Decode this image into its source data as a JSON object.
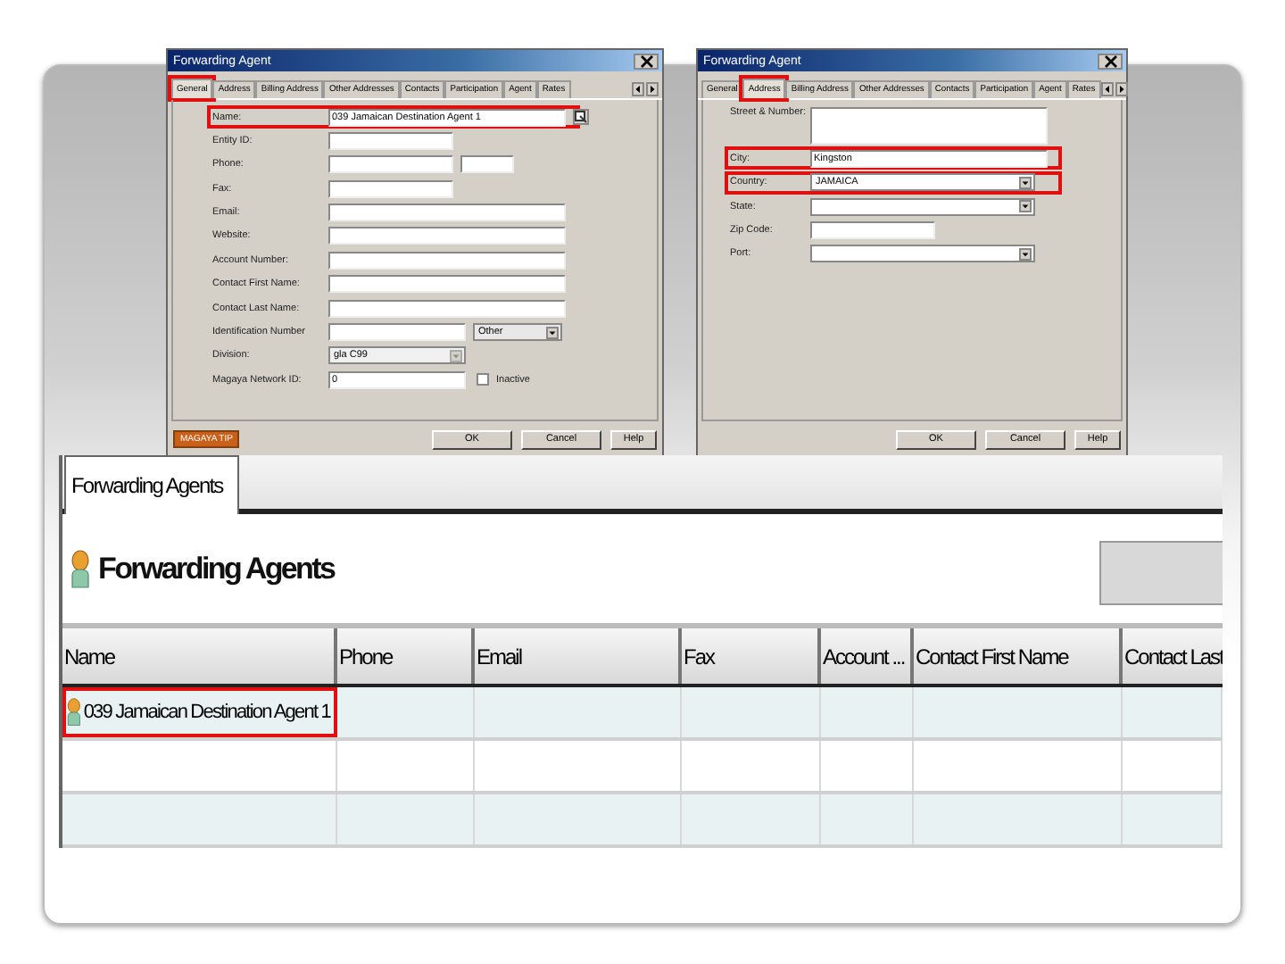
{
  "dialogs": [
    {
      "title": "Forwarding Agent",
      "tabs": [
        {
          "label": "General",
          "selected": true,
          "highlighted": true
        },
        {
          "label": "Address",
          "selected": false,
          "highlighted": false
        },
        {
          "label": "Billing Address",
          "selected": false,
          "highlighted": false
        },
        {
          "label": "Other Addresses",
          "selected": false,
          "highlighted": false
        },
        {
          "label": "Contacts",
          "selected": false,
          "highlighted": false
        },
        {
          "label": "Participation",
          "selected": false,
          "highlighted": false
        },
        {
          "label": "Agent",
          "selected": false,
          "highlighted": false
        },
        {
          "label": "Rates",
          "selected": false,
          "highlighted": false
        }
      ],
      "fields": [
        {
          "kind": "lookup",
          "label": "Name:",
          "value": "039 Jamaican Destination Agent 1",
          "highlighted": true
        },
        {
          "kind": "short",
          "label": "Entity ID:",
          "highlighted": false
        },
        {
          "kind": "pair",
          "label": "Phone:",
          "highlighted": false
        },
        {
          "kind": "short",
          "label": "Fax:",
          "highlighted": false
        },
        {
          "kind": "long",
          "label": "Email:",
          "highlighted": false
        },
        {
          "kind": "long",
          "label": "Website:",
          "highlighted": false
        },
        {
          "kind": "long",
          "label": "Account Number:",
          "highlighted": false
        },
        {
          "kind": "long",
          "label": "Contact First Name:",
          "highlighted": false
        },
        {
          "kind": "long",
          "label": "Contact Last Name:",
          "highlighted": false
        },
        {
          "kind": "text_select",
          "label": "Identification Number",
          "option": "Other",
          "highlighted": false
        },
        {
          "kind": "select_short",
          "label": "Division:",
          "value": "gla C99",
          "highlighted": false
        },
        {
          "kind": "text_check",
          "label": "Magaya Network ID:",
          "value": "0",
          "check_label": "Inactive",
          "checked": false,
          "highlighted": false
        }
      ],
      "badge": "MAGAYA TIP",
      "buttons": [
        "OK",
        "Cancel",
        "Help"
      ]
    },
    {
      "title": "Forwarding Agent",
      "tabs": [
        {
          "label": "General",
          "selected": false,
          "highlighted": false
        },
        {
          "label": "Address",
          "selected": true,
          "highlighted": true
        },
        {
          "label": "Billing Address",
          "selected": false,
          "highlighted": false
        },
        {
          "label": "Other Addresses",
          "selected": false,
          "highlighted": false
        },
        {
          "label": "Contacts",
          "selected": false,
          "highlighted": false
        },
        {
          "label": "Participation",
          "selected": false,
          "highlighted": false
        },
        {
          "label": "Agent",
          "selected": false,
          "highlighted": false
        },
        {
          "label": "Rates",
          "selected": false,
          "highlighted": false
        }
      ],
      "fields": [
        {
          "kind": "textarea",
          "label": "Street & Number:",
          "highlighted": false
        },
        {
          "kind": "long",
          "label": "City:",
          "value": "Kingston",
          "highlighted": true
        },
        {
          "kind": "select_long",
          "label": "Country:",
          "value": "JAMAICA",
          "highlighted": true
        },
        {
          "kind": "select_long",
          "label": "State:",
          "highlighted": false
        },
        {
          "kind": "short",
          "label": "Zip Code:",
          "highlighted": false
        },
        {
          "kind": "select_long",
          "label": "Port:",
          "highlighted": false
        }
      ],
      "buttons": [
        "OK",
        "Cancel",
        "Help"
      ]
    }
  ],
  "app": {
    "tabs": [
      {
        "label": "Forwarding Agents",
        "selected": true
      }
    ],
    "heading": "Forwarding Agents",
    "table": {
      "columns": [
        "Name",
        "Phone",
        "Email",
        "Fax",
        "Account ...",
        "Contact First Name",
        "Contact Last"
      ],
      "rows": [
        {
          "cells": [
            "039 Jamaican Destination Agent 1"
          ],
          "highlighted": true
        }
      ]
    }
  }
}
